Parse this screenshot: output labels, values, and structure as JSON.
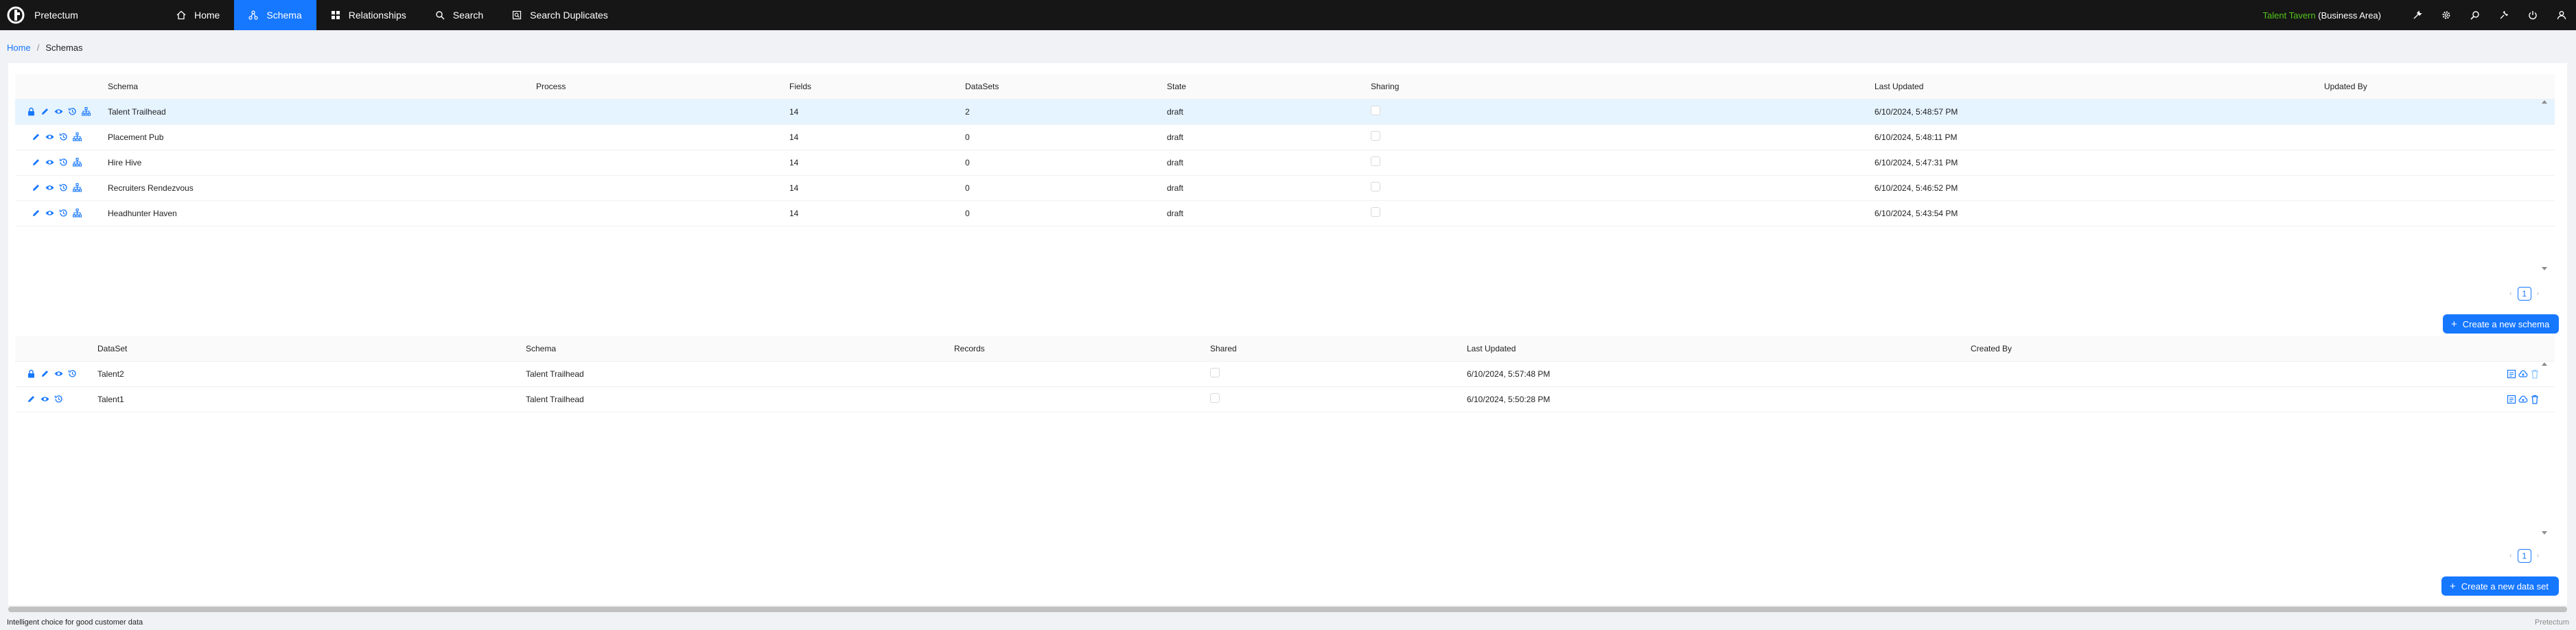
{
  "app": {
    "name": "Pretectum"
  },
  "nav": [
    {
      "label": "Home",
      "icon": "home-icon",
      "active": false
    },
    {
      "label": "Schema",
      "icon": "schema-icon",
      "active": true
    },
    {
      "label": "Relationships",
      "icon": "relationships-icon",
      "active": false
    },
    {
      "label": "Search",
      "icon": "search-icon",
      "active": false
    },
    {
      "label": "Search Duplicates",
      "icon": "duplicates-icon",
      "active": false
    }
  ],
  "tenant": {
    "name": "Talent Tavern",
    "area": "(Business Area)"
  },
  "breadcrumb": {
    "home": "Home",
    "sep": "/",
    "current": "Schemas"
  },
  "schemas": {
    "columns": [
      "Schema",
      "Process",
      "Fields",
      "DataSets",
      "State",
      "Sharing",
      "Last Updated",
      "Updated By"
    ],
    "rows": [
      {
        "schema": "Talent Trailhead",
        "process": "",
        "fields": "14",
        "datasets": "2",
        "state": "draft",
        "last_updated": "6/10/2024, 5:48:57 PM",
        "updated_by": "",
        "locked": true,
        "selected": true
      },
      {
        "schema": "Placement Pub",
        "process": "",
        "fields": "14",
        "datasets": "0",
        "state": "draft",
        "last_updated": "6/10/2024, 5:48:11 PM",
        "updated_by": "",
        "locked": false,
        "selected": false
      },
      {
        "schema": "Hire Hive",
        "process": "",
        "fields": "14",
        "datasets": "0",
        "state": "draft",
        "last_updated": "6/10/2024, 5:47:31 PM",
        "updated_by": "",
        "locked": false,
        "selected": false
      },
      {
        "schema": "Recruiters Rendezvous",
        "process": "",
        "fields": "14",
        "datasets": "0",
        "state": "draft",
        "last_updated": "6/10/2024, 5:46:52 PM",
        "updated_by": "",
        "locked": false,
        "selected": false
      },
      {
        "schema": "Headhunter Haven",
        "process": "",
        "fields": "14",
        "datasets": "0",
        "state": "draft",
        "last_updated": "6/10/2024, 5:43:54 PM",
        "updated_by": "",
        "locked": false,
        "selected": false
      }
    ],
    "page": "1",
    "create_label": "Create a new schema"
  },
  "datasets": {
    "columns": [
      "DataSet",
      "Schema",
      "Records",
      "Shared",
      "Last Updated",
      "Created By"
    ],
    "rows": [
      {
        "dataset": "Talent2",
        "schema": "Talent Trailhead",
        "records": "",
        "last_updated": "6/10/2024, 5:57:48 PM",
        "created_by": "",
        "locked": true
      },
      {
        "dataset": "Talent1",
        "schema": "Talent Trailhead",
        "records": "",
        "last_updated": "6/10/2024, 5:50:28 PM",
        "created_by": "",
        "locked": false
      }
    ],
    "page": "1",
    "create_label": "Create a new data set"
  },
  "footer": {
    "tagline": "Intelligent choice for good customer data",
    "brand": "Pretectum"
  },
  "colors": {
    "accent": "#1677ff",
    "topbar": "#161616",
    "tenant": "#52c41a",
    "selected_row": "#e6f4ff"
  }
}
